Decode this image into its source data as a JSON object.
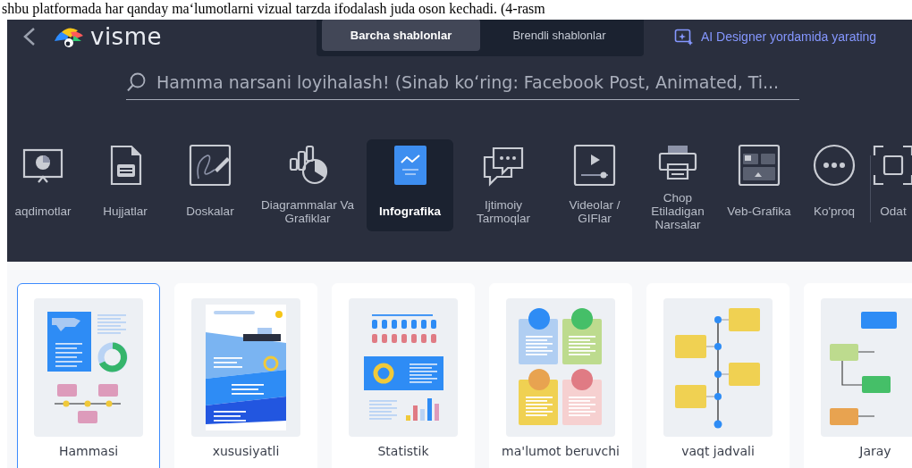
{
  "document_text": "shbu platformada har qanday maʻlumotlarni vizual tarzda ifodalash juda oson kechadi. (4-rasm",
  "header": {
    "logo_text": "visme",
    "tabs": [
      {
        "label": "Barcha shablonlar",
        "selected": true
      },
      {
        "label": "Brendli shablonlar",
        "selected": false
      }
    ],
    "ai_link": "AI Designer yordamida yarating"
  },
  "search": {
    "placeholder": "Hamma narsani loyihalash! (Sinab koʻring: Facebook Post, Animated, Ti..."
  },
  "categories": [
    {
      "label": "aqdimotlar",
      "kind": "presentation",
      "selected": false
    },
    {
      "label": "Hujjatlar",
      "kind": "document",
      "selected": false
    },
    {
      "label": "Doskalar",
      "kind": "whiteboard",
      "selected": false
    },
    {
      "label": "Diagrammalar Va Grafiklar",
      "kind": "chart",
      "selected": false
    },
    {
      "label": "Infografika",
      "kind": "infographic",
      "selected": true
    },
    {
      "label": "Ijtimoiy Tarmoqlar",
      "kind": "social",
      "selected": false
    },
    {
      "label": "Videolar / GIFlar",
      "kind": "video",
      "selected": false
    },
    {
      "label": "Chop Etiladigan Narsalar",
      "kind": "print",
      "selected": false
    },
    {
      "label": "Veb-Grafika",
      "kind": "web",
      "selected": false
    },
    {
      "label": "Ko'proq",
      "kind": "more",
      "selected": false
    },
    {
      "label": "Odat",
      "kind": "custom",
      "selected": false
    }
  ],
  "cards": [
    {
      "label": "Hammasi",
      "kind": "all",
      "selected": true
    },
    {
      "label": "xususiyatli",
      "kind": "featured",
      "selected": false
    },
    {
      "label": "Statistik",
      "kind": "statistic",
      "selected": false
    },
    {
      "label": "ma'lumot beruvchi",
      "kind": "informational",
      "selected": false
    },
    {
      "label": "vaqt jadvali",
      "kind": "timeline",
      "selected": false
    },
    {
      "label": "Jaray",
      "kind": "process",
      "selected": false
    }
  ]
}
